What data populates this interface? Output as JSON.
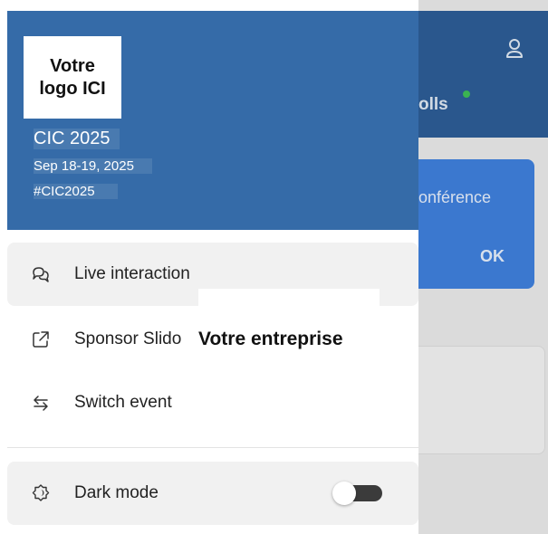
{
  "logo": {
    "text": "Votre\nlogo ICI"
  },
  "event": {
    "name": "CIC 2025",
    "dates": "Sep 18-19, 2025",
    "hashtag": "#CIC2025"
  },
  "menu": {
    "items": [
      {
        "label": "Live interaction",
        "icon": "chat-bubbles-icon",
        "active": true
      },
      {
        "label": "Sponsor Slido",
        "icon": "external-link-icon"
      },
      {
        "label": "Switch event",
        "icon": "switch-arrows-icon"
      }
    ],
    "dark_mode": {
      "label": "Dark mode",
      "icon": "dark-mode-icon",
      "enabled": false
    }
  },
  "overlay": {
    "company": "Votre entreprise"
  },
  "background": {
    "polls_label": "olls",
    "card_text": "onférence",
    "card_button": "OK",
    "user_icon": "user-icon"
  },
  "colors": {
    "header": "#356ba8",
    "bg_header": "#2d5d96",
    "bg_card": "#3f80dc",
    "status_dot": "#3fbf57"
  }
}
